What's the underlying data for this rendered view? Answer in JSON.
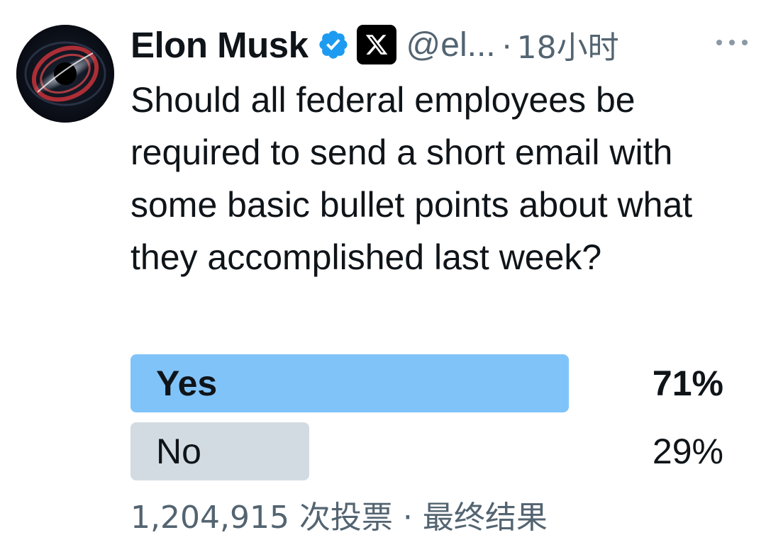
{
  "tweet": {
    "author": {
      "name": "Elon Musk",
      "handle": "@el...",
      "separator": "·",
      "time": "18小时",
      "verified": true,
      "avatar": "black-hole-avatar"
    },
    "text": "Should all federal employees be required to send a short email with some basic bullet points about what they accomplished last week?",
    "more_icon": "more-horizontal-icon"
  },
  "poll": {
    "options": [
      {
        "label": "Yes",
        "percent_text": "71%",
        "percent": 71,
        "color": "#80c3f8",
        "winner": true
      },
      {
        "label": "No",
        "percent_text": "29%",
        "percent": 29,
        "color": "#d3dbe2",
        "winner": false
      }
    ],
    "votes": "1,204,915 次投票",
    "separator": "·",
    "status": "最终结果"
  },
  "colors": {
    "text_primary": "#0f1419",
    "text_secondary": "#536471",
    "verified_blue": "#1d9bf0",
    "winner_bar": "#80c3f8",
    "loser_bar": "#d3dbe2"
  }
}
